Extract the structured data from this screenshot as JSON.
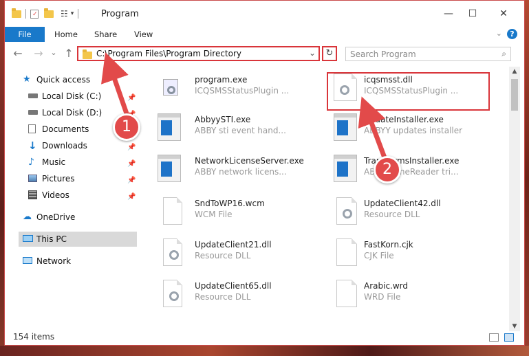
{
  "window": {
    "title": "Program",
    "min_glyph": "—",
    "max_glyph": "☐",
    "close_glyph": "✕"
  },
  "ribbon": {
    "tabs": [
      "File",
      "Home",
      "Share",
      "View"
    ],
    "help": "?",
    "collapse": "⌄"
  },
  "nav": {
    "back": "←",
    "forward": "→",
    "recent": "⌄",
    "up": "↑",
    "address": "C:\\Program Files\\Program Directory",
    "address_dropdown": "⌄",
    "refresh": "↻",
    "search_placeholder": "Search Program",
    "search_glyph": "⌕"
  },
  "sidebar": {
    "items": [
      {
        "label": "Quick access",
        "icon": "star-icon"
      },
      {
        "label": "Local Disk (C:)",
        "icon": "drive-icon",
        "pinned": true
      },
      {
        "label": "Local Disk (D:)",
        "icon": "drive-icon",
        "pinned": true
      },
      {
        "label": "Documents",
        "icon": "documents-icon",
        "pinned": true
      },
      {
        "label": "Downloads",
        "icon": "download-icon",
        "pinned": true
      },
      {
        "label": "Music",
        "icon": "music-icon",
        "pinned": true
      },
      {
        "label": "Pictures",
        "icon": "pictures-icon",
        "pinned": true
      },
      {
        "label": "Videos",
        "icon": "videos-icon",
        "pinned": true
      },
      {
        "label": "OneDrive",
        "icon": "cloud-icon"
      },
      {
        "label": "This PC",
        "icon": "computer-icon",
        "selected": true
      },
      {
        "label": "Network",
        "icon": "network-icon"
      }
    ]
  },
  "files": [
    {
      "name": "program.exe",
      "desc": "ICQSMSStatusPlugin ...",
      "type": "program"
    },
    {
      "name": "icqsmsst.dll",
      "desc": "ICQSMSStatusPlugin ...",
      "type": "dll"
    },
    {
      "name": "AbbyySTI.exe",
      "desc": "ABBY sti event hand...",
      "type": "app"
    },
    {
      "name": "UpdateInstaller.exe",
      "desc": "ABBYY updates installer",
      "type": "app"
    },
    {
      "name": "NetworkLicenseServer.exe",
      "desc": "ABBY network licens...",
      "type": "app"
    },
    {
      "name": "TransformsInstaller.exe",
      "desc": "ABBYY FineReader tri...",
      "type": "app"
    },
    {
      "name": "SndToWP16.wcm",
      "desc": "WCM File",
      "type": "doc"
    },
    {
      "name": "UpdateClient42.dll",
      "desc": "Resource DLL",
      "type": "dll"
    },
    {
      "name": "UpdateClient21.dll",
      "desc": "Resource DLL",
      "type": "dll"
    },
    {
      "name": "FastKorn.cjk",
      "desc": "CJK File",
      "type": "doc"
    },
    {
      "name": "UpdateClient65.dll",
      "desc": "Resource DLL",
      "type": "dll"
    },
    {
      "name": "Arabic.wrd",
      "desc": "WRD File",
      "type": "doc"
    }
  ],
  "status": {
    "item_count": "154 items"
  },
  "annotations": {
    "step1": "1",
    "step2": "2"
  },
  "colors": {
    "accent": "#1979ca",
    "highlight": "#d9353a",
    "badge": "#e24a4a"
  }
}
